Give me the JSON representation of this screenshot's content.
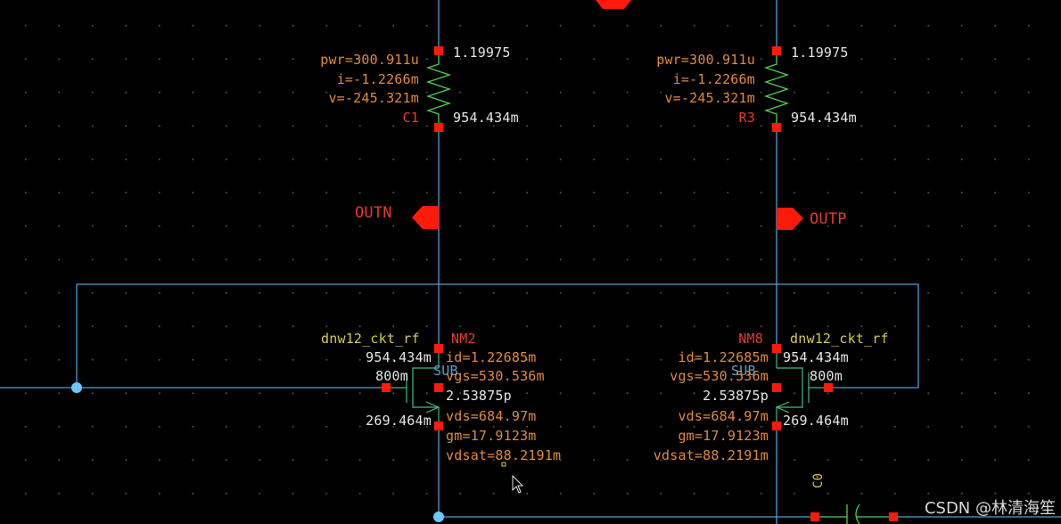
{
  "colors": {
    "wire": "#4d9fd6",
    "pin": "#ff1a0a",
    "resistor": "#4fd04f",
    "orange": "#e08a3c",
    "white": "#e6e6e6",
    "red": "#e43b2c",
    "yellow": "#d8c94a"
  },
  "left_resistor": {
    "pwr": "pwr=300.911u",
    "i": "i=-1.2266m",
    "v": "v=-245.321m",
    "name": "C1",
    "top_voltage": "1.19975",
    "bottom_voltage": "954.434m"
  },
  "right_resistor": {
    "pwr": "pwr=300.911u",
    "i": "i=-1.2266m",
    "v": "v=-245.321m",
    "name": "R3",
    "top_voltage": "1.19975",
    "bottom_voltage": "954.434m"
  },
  "left_pin": {
    "label": "OUTN"
  },
  "right_pin": {
    "label": "OUTP"
  },
  "left_transistor": {
    "model": "dnw12_ckt_rf",
    "name": "NM2",
    "drain_v": "954.434m",
    "gate_v": "800m",
    "source_v": "269.464m",
    "sub": "SUB",
    "id": "id=1.22685m",
    "vgs": "vgs=530.536m",
    "cap": "2.53875p",
    "vds": "vds=684.97m",
    "gm": "gm=17.9123m",
    "vdsat": "vdsat=88.2191m"
  },
  "right_transistor": {
    "model": "dnw12_ckt_rf",
    "name": "NM8",
    "drain_v": "954.434m",
    "gate_v": "800m",
    "source_v": "269.464m",
    "sub": "SUB",
    "id": "id=1.22685m",
    "vgs": "vgs=530.536m",
    "cap": "2.53875p",
    "vds": "vds=684.97m",
    "gm": "gm=17.9123m",
    "vdsat": "vdsat=88.2191m"
  },
  "bottom_cap": {
    "name": "C0"
  },
  "watermark": "CSDN @林清海笙"
}
